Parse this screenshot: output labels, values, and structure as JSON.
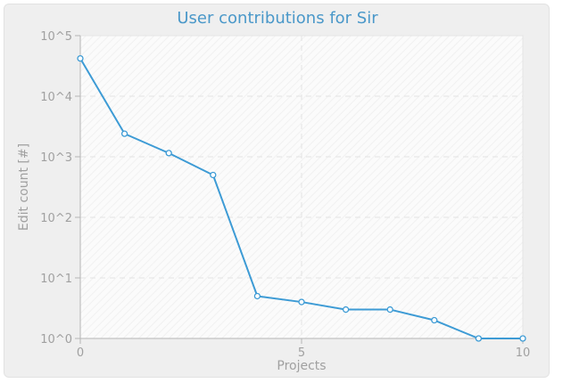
{
  "chart_data": {
    "type": "line",
    "title": "User contributions for Sir",
    "xlabel": "Projects",
    "ylabel": "Edit count [#]",
    "x_ticks": [
      "0",
      "5",
      "10"
    ],
    "x_tick_values": [
      0,
      5,
      10
    ],
    "y_scale": "log",
    "y_ticks": [
      "10^0",
      "10^1",
      "10^2",
      "10^3",
      "10^4",
      "10^5"
    ],
    "y_tick_values": [
      1,
      10,
      100,
      1000,
      10000,
      100000
    ],
    "xlim": [
      0,
      10
    ],
    "ylim": [
      1,
      100000
    ],
    "grid": true,
    "series": [
      {
        "x": [
          0,
          1,
          2,
          3,
          4,
          5,
          6,
          7,
          8,
          9,
          10
        ],
        "values": [
          42000,
          2400,
          1150,
          500,
          5,
          4,
          3,
          3,
          2,
          1,
          1
        ]
      }
    ],
    "colors": {
      "line": "#3d9bd5",
      "title": "#4a98c9",
      "grid": "#e3e3e3",
      "text": "#a0a0a0"
    }
  }
}
